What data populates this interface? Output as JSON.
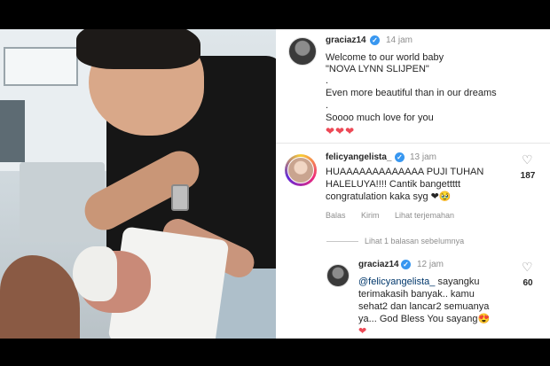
{
  "post": {
    "username": "graciaz14",
    "time": "14 jam",
    "lines": [
      "Welcome to our world baby",
      "\"NOVA LYNN SLIJPEN\"",
      ".",
      "Even more beautiful than in our dreams",
      ".",
      "Soooo much love for you"
    ],
    "hearts": "❤❤❤"
  },
  "comments": [
    {
      "username": "felicyangelista_",
      "time": "13 jam",
      "text_lines": [
        "HUAAAAAAAAAAAAA PUJI TUHAN",
        "HALELUYA!!!! Cantik bangettttt",
        "congratulation kaka syg ❤🥹"
      ],
      "likes": "187",
      "actions": [
        "Balas",
        "Kirim",
        "Lihat terjemahan"
      ]
    }
  ],
  "replies_toggle": "Lihat 1 balasan sebelumnya",
  "reply": {
    "username": "graciaz14",
    "time": "12 jam",
    "mention": "@felicyangelista_",
    "text_lines": [
      " sayangku",
      "terimakasih banyak.. kamu",
      "sehat2 dan lancar2 semuanya",
      "ya... God Bless You sayang😍",
      "❤"
    ],
    "likes": "60"
  },
  "icons": {
    "like": "heart-outline-icon",
    "verified": "verified-badge-icon"
  },
  "colors": {
    "verified": "#3897f0",
    "heart": "#ed4956",
    "muted": "#8e8e8e"
  }
}
